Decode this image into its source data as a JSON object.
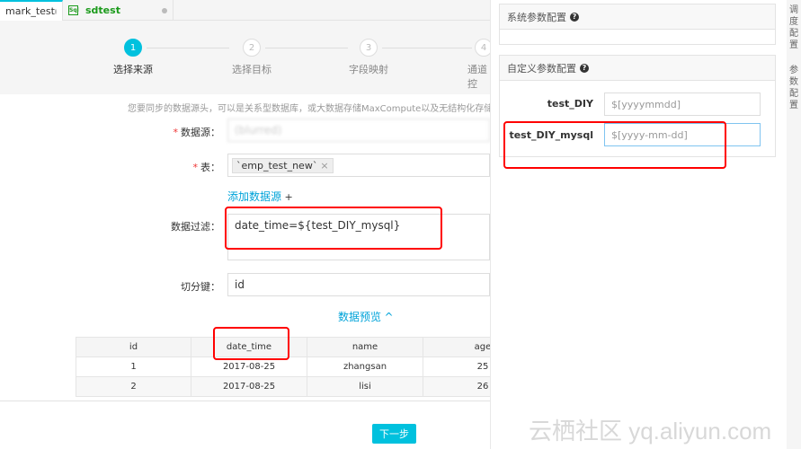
{
  "tabs": [
    {
      "label": "mark_test"
    },
    {
      "label": "sdtest",
      "icon": "sql-file-icon"
    }
  ],
  "steps": [
    {
      "num": "1",
      "label": "选择来源",
      "active": true
    },
    {
      "num": "2",
      "label": "选择目标"
    },
    {
      "num": "3",
      "label": "字段映射"
    },
    {
      "num": "4",
      "label": "通道控"
    }
  ],
  "description": "您要同步的数据源头，可以是关系型数据库，或大数据存储MaxCompute以及无结构化存储等",
  "form": {
    "datasource_label": "数据源：",
    "datasource_value": "(blurred)",
    "table_label": "表：",
    "table_chip": "`emp_test_new`",
    "chip_close": "×",
    "add_source": "添加数据源",
    "add_plus": "+",
    "filter_label": "数据过滤：",
    "filter_value": "date_time=${test_DIY_mysql}",
    "split_label": "切分键：",
    "split_value": "id",
    "preview": "数据预览",
    "preview_chevron": "^"
  },
  "table": {
    "columns": [
      "id",
      "date_time",
      "name",
      "age"
    ],
    "rows": [
      [
        "1",
        "2017-08-25",
        "zhangsan",
        "25"
      ],
      [
        "2",
        "2017-08-25",
        "lisi",
        "26"
      ]
    ]
  },
  "next_button": "下一步",
  "right": {
    "system_title": "系统参数配置",
    "custom_title": "自定义参数配置",
    "params": [
      {
        "name": "test_DIY",
        "value": "$[yyyymmdd]"
      },
      {
        "name": "test_DIY_mysql",
        "value": "$[yyyy-mm-dd]"
      }
    ]
  },
  "side_tabs": [
    "调度配置",
    "参数配置"
  ],
  "watermark": "云栖社区 yq.aliyun.com",
  "colors": {
    "accent": "#00c1de",
    "highlight": "#ff0000",
    "link": "#00a3d9"
  }
}
